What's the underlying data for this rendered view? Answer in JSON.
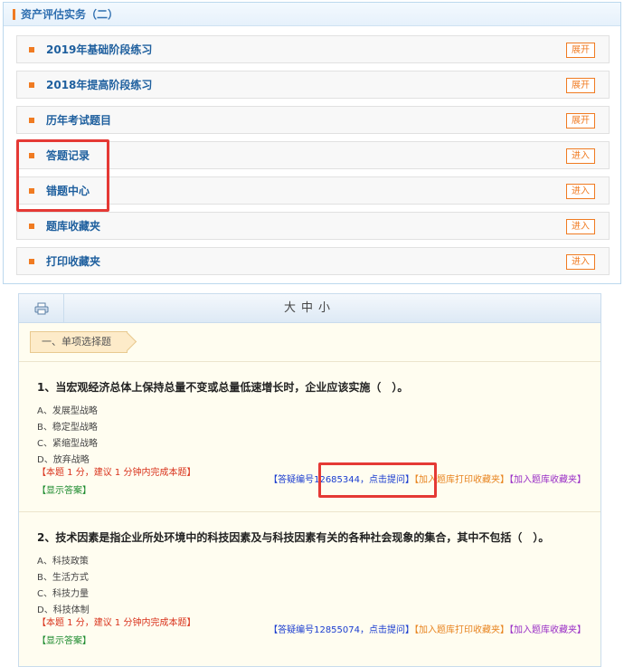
{
  "panel": {
    "title": "资产评估实务（二）",
    "rows": [
      {
        "label": "2019年基础阶段练习",
        "button": "展开"
      },
      {
        "label": "2018年提高阶段练习",
        "button": "展开"
      },
      {
        "label": "历年考试题目",
        "button": "展开"
      },
      {
        "label": "答题记录",
        "button": "进入"
      },
      {
        "label": "错题中心",
        "button": "进入"
      },
      {
        "label": "题库收藏夹",
        "button": "进入"
      },
      {
        "label": "打印收藏夹",
        "button": "进入"
      }
    ]
  },
  "toolbar": {
    "print_icon": "printer-icon",
    "size_large": "大",
    "size_medium": "中",
    "size_small": "小"
  },
  "section": {
    "label": "一、单项选择题"
  },
  "questions": [
    {
      "title": "1、当宏观经济总体上保持总量不变或总量低速增长时，企业应该实施（　）。",
      "options": [
        "A、发展型战略",
        "B、稳定型战略",
        "C、紧缩型战略",
        "D、放弃战略"
      ],
      "hint": "【本题 1 分，建议 1 分钟内完成本题】",
      "show_answer": "【显示答案】",
      "ask": "【答疑编号12685344，点击提问】",
      "add_print": "【加入题库打印收藏夹】",
      "add_fav": "【加入题库收藏夹】"
    },
    {
      "title": "2、技术因素是指企业所处环境中的科技因素及与科技因素有关的各种社会现象的集合，其中不包括（　）。",
      "options": [
        "A、科技政策",
        "B、生活方式",
        "C、科技力量",
        "D、科技体制"
      ],
      "hint": "【本题 1 分，建议 1 分钟内完成本题】",
      "show_answer": "【显示答案】",
      "ask": "【答疑编号12855074，点击提问】",
      "add_print": "【加入题库打印收藏夹】",
      "add_fav": "【加入题库收藏夹】"
    }
  ],
  "colors": {
    "accent": "#f07b22",
    "link_blue": "#1e5f9e",
    "highlight_red": "#e53935"
  }
}
